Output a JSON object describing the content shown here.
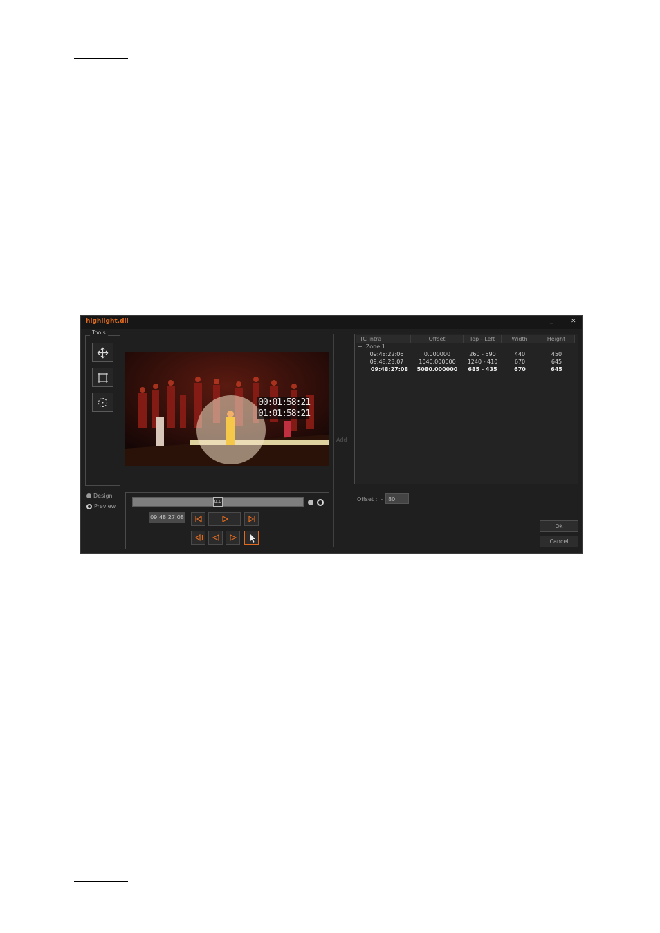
{
  "window": {
    "title": "highlight.dll",
    "minimize_glyph": "_",
    "close_glyph": "✕"
  },
  "tools": {
    "label": "Tools",
    "items": [
      {
        "name": "move-icon"
      },
      {
        "name": "rectangle-icon"
      },
      {
        "name": "ellipse-icon"
      }
    ]
  },
  "mode": {
    "options": [
      "Design",
      "Preview"
    ],
    "selected": "Preview"
  },
  "video": {
    "timecode_top": "00:01:58:21",
    "timecode_bottom": "01:01:58:21"
  },
  "player": {
    "slider_label": "0.0",
    "timecode": "09:48:27:08",
    "buttons_row1": [
      "go-to-start-icon",
      "play-icon",
      "go-to-end-icon"
    ],
    "buttons_row2": [
      "previous-keyframe-icon",
      "step-back-icon",
      "step-forward-icon",
      "pointer-icon"
    ]
  },
  "add_label": "Add",
  "table": {
    "columns": [
      "TC Intra",
      "Offset",
      "Top - Left",
      "Width",
      "Height"
    ],
    "group": "Zone 1",
    "group_toggle": "−",
    "rows": [
      [
        "09:48:22:06",
        "0.000000",
        "260 - 590",
        "440",
        "450"
      ],
      [
        "09:48:23:07",
        "1040.000000",
        "1240 - 410",
        "670",
        "645"
      ],
      [
        "09:48:27:08",
        "5080.000000",
        "685 - 435",
        "670",
        "645"
      ]
    ],
    "highlighted_row": 2
  },
  "offset": {
    "label": "Offset :",
    "sign": "-",
    "value": "80"
  },
  "buttons": {
    "ok": "Ok",
    "cancel": "Cancel"
  },
  "colors": {
    "accent": "#e06a1e",
    "window_bg": "#1f1f1f"
  }
}
